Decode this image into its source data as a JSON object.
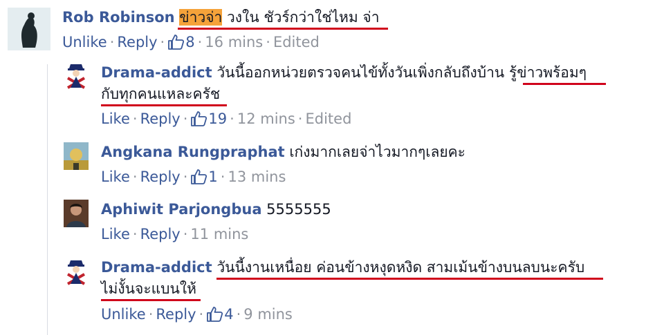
{
  "comments": [
    {
      "author": "Rob Robinson",
      "text_highlight": "ข่าวจ่า",
      "text_rest": " วงใน ชัวร์กว่าใช่ไหม จ่า",
      "actions": {
        "like": "Unlike",
        "reply": "Reply",
        "likes": "8",
        "time": "16 mins",
        "edited": "Edited"
      }
    },
    {
      "author": "Drama-addict",
      "text_line1": " วันนี้ออกหน่วยตรวจคนไข้ทั้งวันเพิ่งกลับถึงบ้าน ",
      "text_line1_ul": "รู้ข่าวพร้อมๆ",
      "text_line2": "กับทุกคนแหละครัช",
      "actions": {
        "like": "Like",
        "reply": "Reply",
        "likes": "19",
        "time": "12 mins",
        "edited": "Edited"
      }
    },
    {
      "author": "Angkana Rungpraphat",
      "text": " เก่งมากเลยจ่าไวมากๆเลยคะ",
      "actions": {
        "like": "Like",
        "reply": "Reply",
        "likes": "1",
        "time": "13 mins"
      }
    },
    {
      "author": "Aphiwit Parjongbua",
      "text": " 5555555",
      "actions": {
        "like": "Like",
        "reply": "Reply",
        "time": "11 mins"
      }
    },
    {
      "author": "Drama-addict",
      "text_line1": "วันนี้งานเหนื่อย ค่อนข้างหงุดหงิด สามเม้นข้างบนลบนะครับ",
      "text_line2": "ไม่งั้นจะแบนให้",
      "actions": {
        "like": "Unlike",
        "reply": "Reply",
        "likes": "4",
        "time": "9 mins"
      }
    }
  ],
  "colors": {
    "link": "#3b5998",
    "muted": "#90949c",
    "highlight": "#f5a23a",
    "underline": "#d0021b"
  }
}
